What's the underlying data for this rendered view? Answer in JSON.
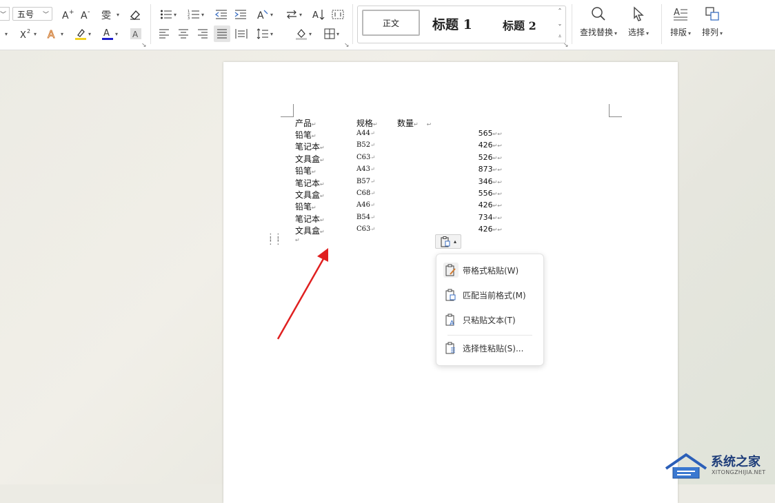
{
  "ribbon": {
    "font_size_value": "五号",
    "styles": {
      "normal": "正文",
      "heading1": "标题 1",
      "heading2": "标题 2"
    },
    "find_replace_label": "查找替换",
    "select_label": "选择",
    "layout_label": "排版",
    "arrange_label": "排列"
  },
  "document": {
    "header": {
      "product": "产品",
      "spec": "规格",
      "quantity": "数量"
    },
    "rows": [
      {
        "product": "铅笔",
        "spec": "A44",
        "qty": "565"
      },
      {
        "product": "笔记本",
        "spec": "B52",
        "qty": "426"
      },
      {
        "product": "文具盒",
        "spec": "C63",
        "qty": "526"
      },
      {
        "product": "铅笔",
        "spec": "A43",
        "qty": "873"
      },
      {
        "product": "笔记本",
        "spec": "B57",
        "qty": "346"
      },
      {
        "product": "文具盒",
        "spec": "C68",
        "qty": "556"
      },
      {
        "product": "铅笔",
        "spec": "A46",
        "qty": "426"
      },
      {
        "product": "笔记本",
        "spec": "B54",
        "qty": "734"
      },
      {
        "product": "文具盒",
        "spec": "C63",
        "qty": "426"
      }
    ],
    "paragraph_mark": "↵",
    "tab_mark": "↩"
  },
  "paste_menu": {
    "items": [
      "带格式粘贴(W)",
      "匹配当前格式(M)",
      "只粘贴文本(T)",
      "选择性粘贴(S)..."
    ]
  },
  "watermark": {
    "title": "系统之家",
    "subtitle": "XITONGZHIJIA.NET"
  },
  "colors": {
    "arrow": "#e02020",
    "font_color_bar": "#1d1dcc",
    "highlight_bar": "#f2d21e",
    "accent_blue": "#3a6fc4"
  }
}
